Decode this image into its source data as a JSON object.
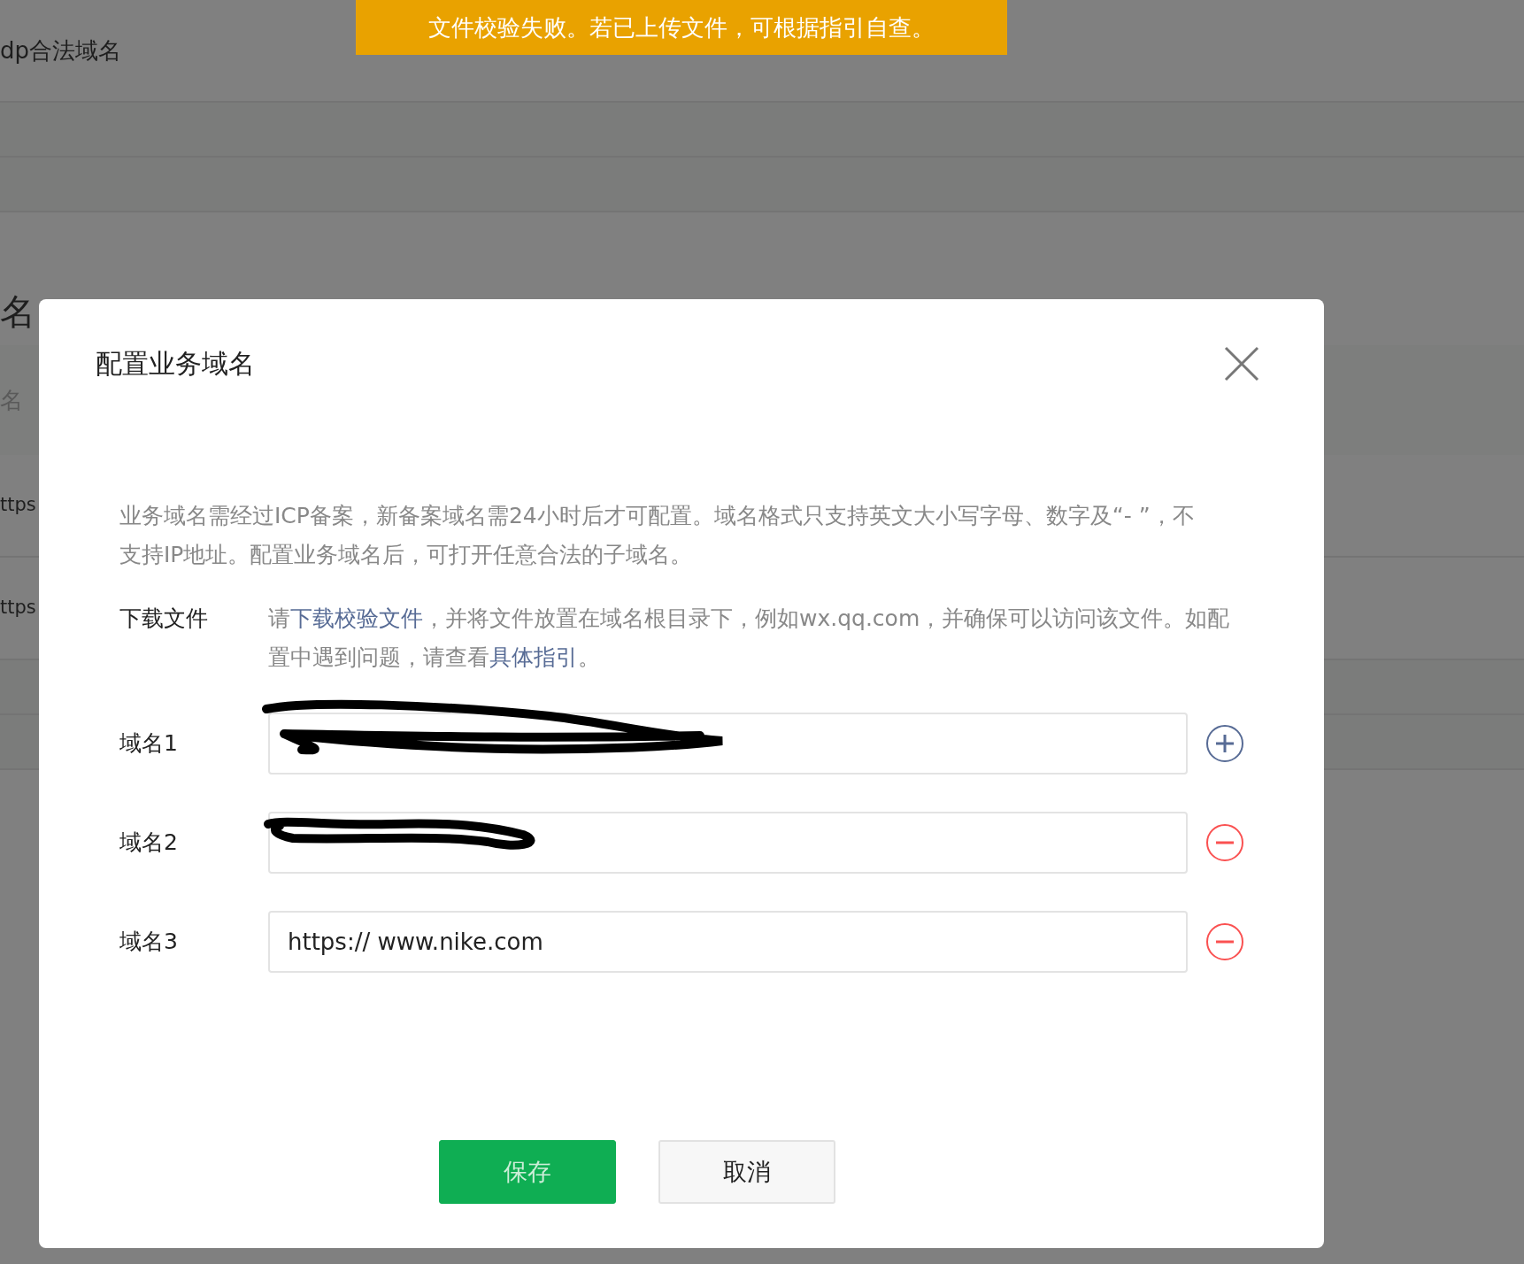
{
  "toast": {
    "text": "文件校验失败。若已上传文件，可根据指引自查。"
  },
  "background": {
    "rows": [
      {
        "kind": "text",
        "text": "dp合法域名"
      },
      {
        "kind": "band"
      },
      {
        "kind": "band"
      },
      {
        "kind": "heading",
        "text": "名"
      },
      {
        "kind": "muted",
        "text": "名"
      },
      {
        "kind": "text",
        "text": "ttps"
      },
      {
        "kind": "text",
        "text": "ttps"
      },
      {
        "kind": "band"
      },
      {
        "kind": "band"
      }
    ]
  },
  "dialog": {
    "title": "配置业务域名",
    "description": "业务域名需经过ICP备案，新备案域名需24小时后才可配置。域名格式只支持英文大小写字母、数字及“- ”，不支持IP地址。配置业务域名后，可打开任意合法的子域名。",
    "download": {
      "label": "下载文件",
      "parts": [
        {
          "kind": "text",
          "text": "请"
        },
        {
          "kind": "link",
          "text": "下载校验文件"
        },
        {
          "kind": "text",
          "text": "，并将文件放置在域名根目录下，例如wx.qq.com，并确保可以访问该文件。如配置中遇到问题，请查看"
        },
        {
          "kind": "link",
          "text": "具体指引"
        },
        {
          "kind": "text",
          "text": "。"
        }
      ]
    },
    "domains": [
      {
        "label": "域名1",
        "redacted": true,
        "kind": "add"
      },
      {
        "label": "域名2",
        "redacted": true,
        "kind": "remove"
      },
      {
        "label": "域名3",
        "redacted": false,
        "value": "https:// www.nike.com",
        "kind": "remove"
      }
    ],
    "buttons": [
      {
        "label": "保存",
        "kind": "primary"
      },
      {
        "label": "取消",
        "kind": "secondary"
      }
    ]
  }
}
